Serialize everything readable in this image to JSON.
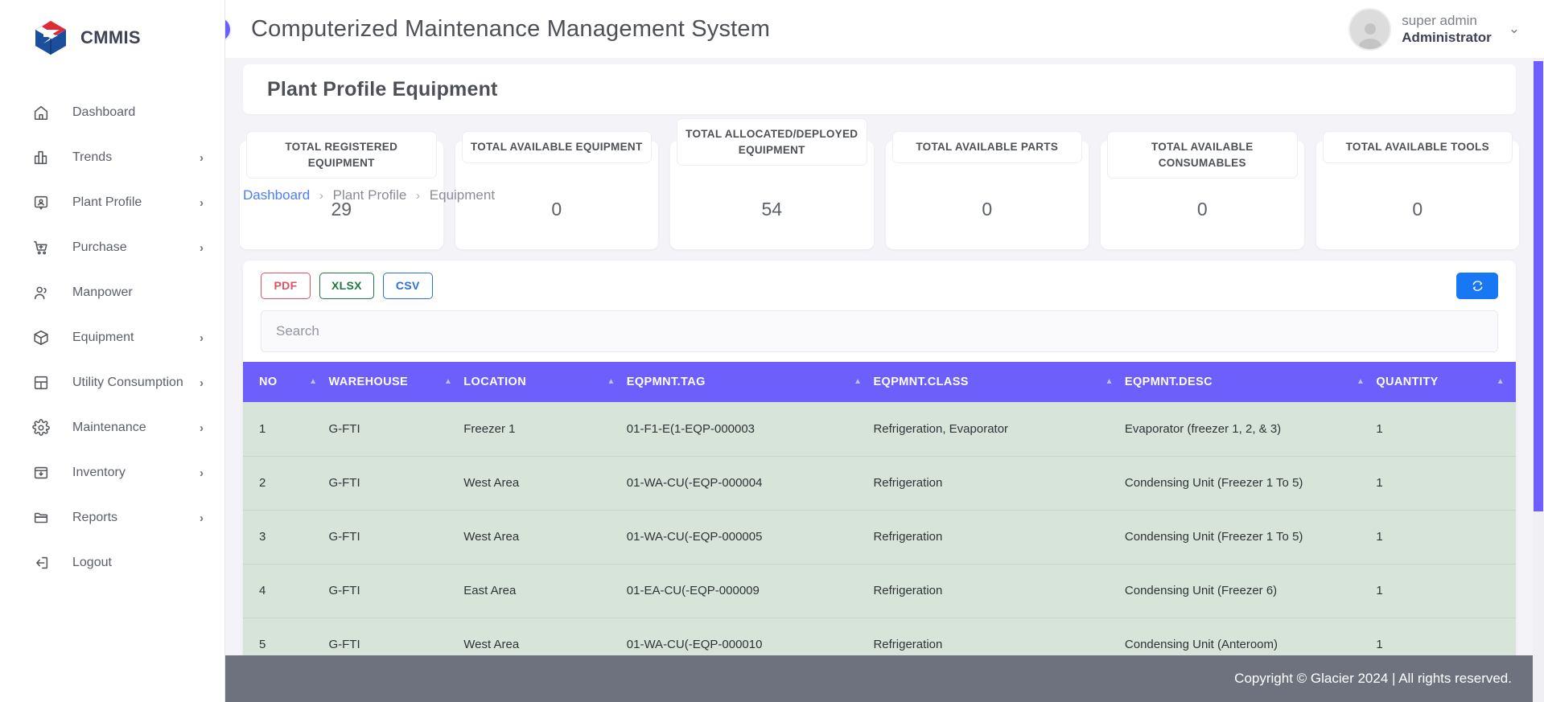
{
  "brand": {
    "name": "CMMIS",
    "logo_icon": "cmmis-logo-icon"
  },
  "sidebar": {
    "items": [
      {
        "label": "Dashboard",
        "icon": "home-icon",
        "caret": ""
      },
      {
        "label": "Trends",
        "icon": "bar-chart-icon",
        "caret": "›"
      },
      {
        "label": "Plant Profile",
        "icon": "id-card-icon",
        "caret": "›"
      },
      {
        "label": "Purchase",
        "icon": "cart-icon",
        "caret": "›"
      },
      {
        "label": "Manpower",
        "icon": "users-icon",
        "caret": ""
      },
      {
        "label": "Equipment",
        "icon": "box-icon",
        "caret": "›"
      },
      {
        "label": "Utility Consumption",
        "icon": "layout-icon",
        "caret": "›"
      },
      {
        "label": "Maintenance",
        "icon": "gear-icon",
        "caret": "›"
      },
      {
        "label": "Inventory",
        "icon": "inbox-icon",
        "caret": "›"
      },
      {
        "label": "Reports",
        "icon": "folder-icon",
        "caret": "›"
      },
      {
        "label": "Logout",
        "icon": "logout-icon",
        "caret": ""
      }
    ]
  },
  "topbar": {
    "collapse_icon": "chevron-left-icon",
    "title": "Computerized Maintenance Management System",
    "user": {
      "name": "super admin",
      "role": "Administrator",
      "caret": "⌄",
      "avatar_icon": "user-avatar-icon"
    }
  },
  "page": {
    "title": "Plant Profile Equipment",
    "breadcrumb": {
      "root": "Dashboard",
      "mid": "Plant Profile",
      "current": "Equipment",
      "separator": "›"
    }
  },
  "stats": [
    {
      "title": "TOTAL REGISTERED EQUIPMENT",
      "value": "29"
    },
    {
      "title": "TOTAL AVAILABLE EQUIPMENT",
      "value": "0"
    },
    {
      "title": "TOTAL ALLOCATED/DEPLOYED EQUIPMENT",
      "value": "54"
    },
    {
      "title": "TOTAL AVAILABLE PARTS",
      "value": "0"
    },
    {
      "title": "TOTAL AVAILABLE CONSUMABLES",
      "value": "0"
    },
    {
      "title": "TOTAL AVAILABLE TOOLS",
      "value": "0"
    }
  ],
  "toolbar": {
    "pdf_label": "PDF",
    "xlsx_label": "XLSX",
    "csv_label": "CSV",
    "refresh_icon": "refresh-sync-icon"
  },
  "search": {
    "placeholder": "Search",
    "value": ""
  },
  "table": {
    "columns": [
      {
        "label": "NO",
        "sort_icon": "▲"
      },
      {
        "label": "WAREHOUSE",
        "sort_icon": "▲"
      },
      {
        "label": "LOCATION",
        "sort_icon": "▲"
      },
      {
        "label": "EQPMNT.TAG",
        "sort_icon": "▲"
      },
      {
        "label": "EQPMNT.CLASS",
        "sort_icon": "▲"
      },
      {
        "label": "EQPMNT.DESC",
        "sort_icon": "▲"
      },
      {
        "label": "QUANTITY",
        "sort_icon": "▲"
      }
    ],
    "rows": [
      {
        "no": "1",
        "warehouse": "G-FTI",
        "location": "Freezer 1",
        "tag": "01-F1-E(1-EQP-000003",
        "class": "Refrigeration, Evaporator",
        "desc": "Evaporator (freezer 1, 2, & 3)",
        "qty": "1"
      },
      {
        "no": "2",
        "warehouse": "G-FTI",
        "location": "West Area",
        "tag": "01-WA-CU(-EQP-000004",
        "class": "Refrigeration",
        "desc": "Condensing Unit (Freezer 1 To 5)",
        "qty": "1"
      },
      {
        "no": "3",
        "warehouse": "G-FTI",
        "location": "West Area",
        "tag": "01-WA-CU(-EQP-000005",
        "class": "Refrigeration",
        "desc": "Condensing Unit (Freezer 1 To 5)",
        "qty": "1"
      },
      {
        "no": "4",
        "warehouse": "G-FTI",
        "location": "East Area",
        "tag": "01-EA-CU(-EQP-000009",
        "class": "Refrigeration",
        "desc": "Condensing Unit (Freezer 6)",
        "qty": "1"
      },
      {
        "no": "5",
        "warehouse": "G-FTI",
        "location": "West Area",
        "tag": "01-WA-CU(-EQP-000010",
        "class": "Refrigeration",
        "desc": "Condensing Unit (Anteroom)",
        "qty": "1"
      }
    ]
  },
  "footer": {
    "text": "Copyright © Glacier 2024  |  All rights reserved."
  },
  "colors": {
    "accent_purple": "#6c5ffc",
    "table_row_green": "#d6e4da",
    "footer_gray": "#6d727e",
    "link_blue": "#4a7dff",
    "refresh_blue": "#1877f2",
    "pdf_red": "#e05260",
    "xlsx_green": "#1f7a3f",
    "csv_blue": "#2a6fe0"
  }
}
